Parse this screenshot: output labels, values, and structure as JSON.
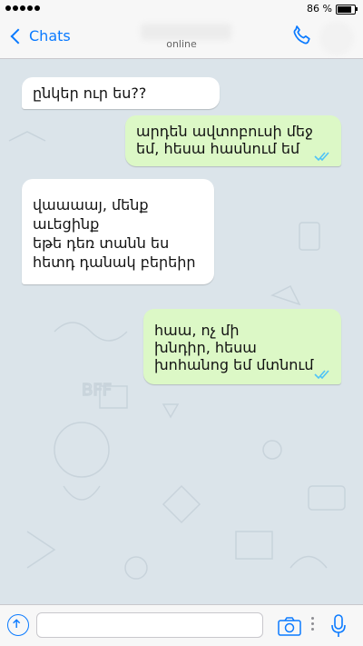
{
  "status_bar": {
    "battery": "86 %",
    "battery_level": 0.86
  },
  "nav": {
    "back_label": "Chats",
    "contact_status": "online",
    "icons": [
      "chevron-left-icon",
      "phone-icon"
    ]
  },
  "messages": [
    {
      "direction": "incoming",
      "text": "ընկեր ուր ես??"
    },
    {
      "direction": "outgoing",
      "text": "արդեն ավտոբուսի մեջ\nեմ, հեսա հասնում եմ",
      "status": "read"
    },
    {
      "direction": "incoming",
      "text": "վաաաայ, մենք\nաւեցինք\nեթե դեռ տանն ես\nհետդ դանակ բերեիր"
    },
    {
      "direction": "outgoing",
      "text": "հաա, ոչ մի\nխնդիր, հեսա\nխոհանոց եմ մտնում",
      "status": "read"
    }
  ],
  "input_bar": {
    "placeholder": "",
    "icons": [
      "upload-icon",
      "camera-icon",
      "more-icon",
      "microphone-icon"
    ]
  },
  "colors": {
    "accent": "#0a7aff",
    "outgoing_bubble": "#dcf8c6",
    "incoming_bubble": "#ffffff",
    "read_ticks": "#4fc3f7"
  }
}
